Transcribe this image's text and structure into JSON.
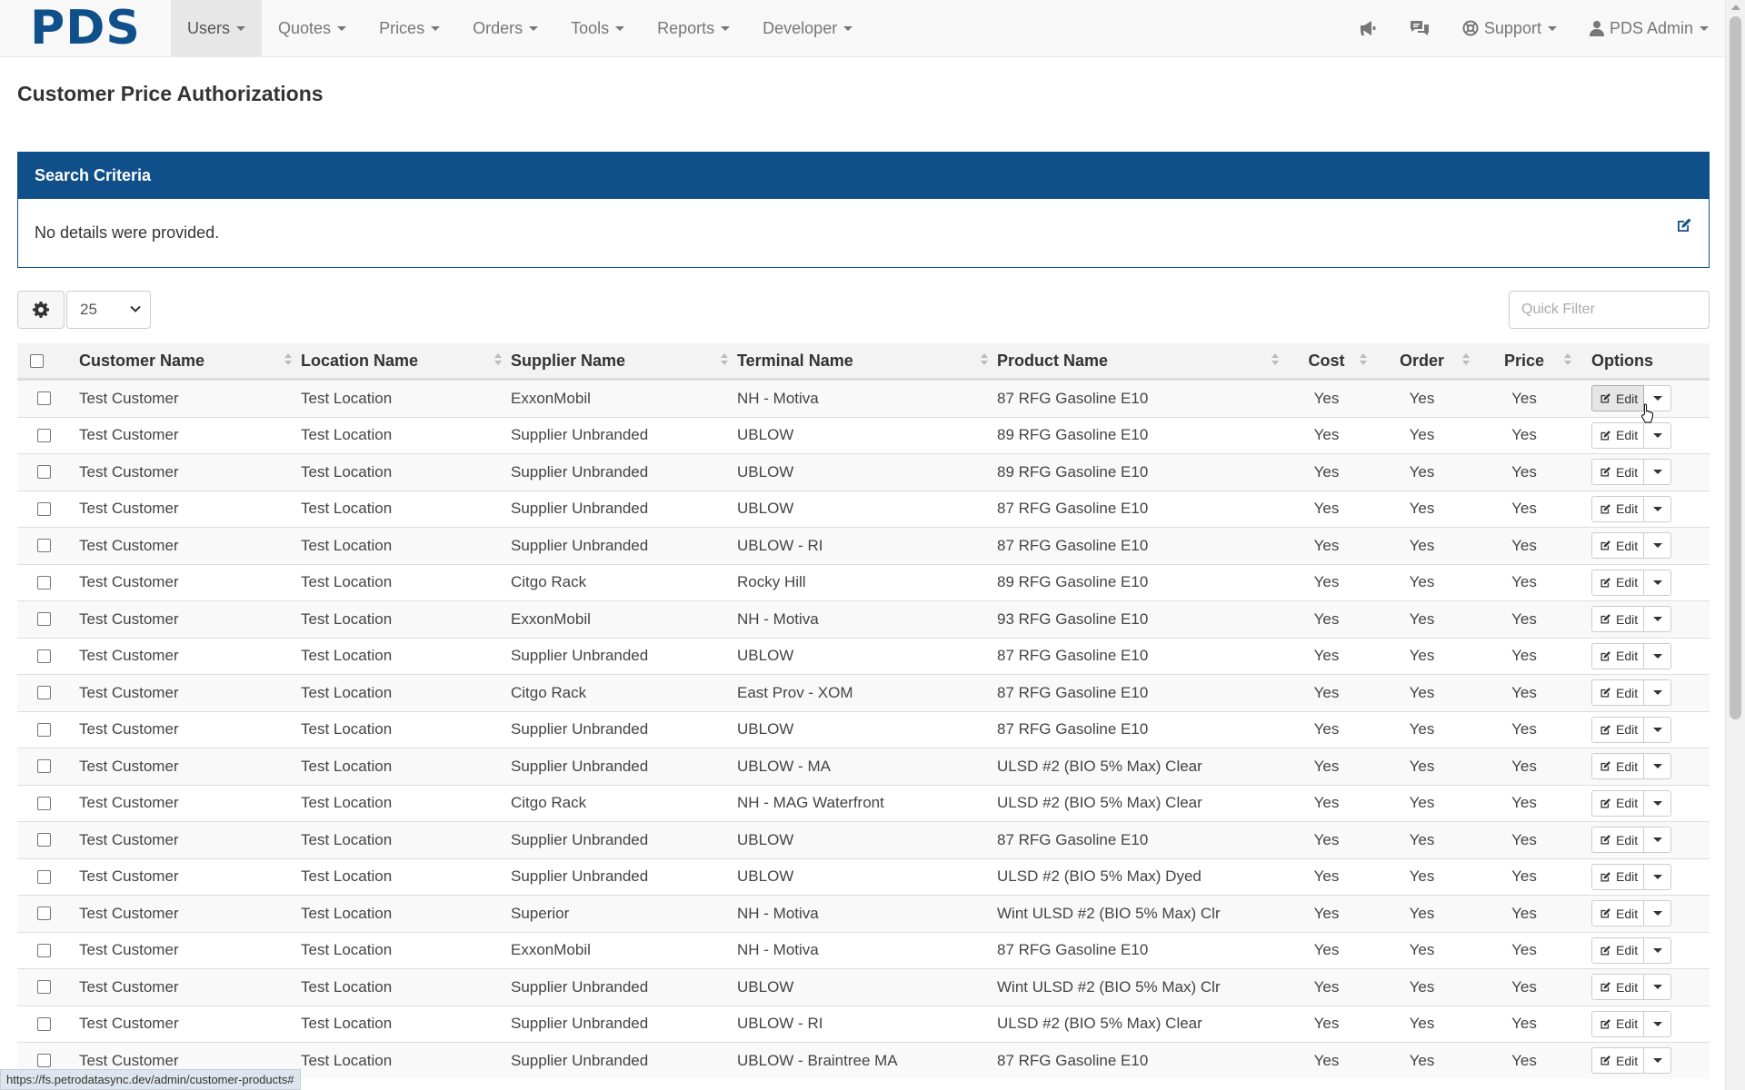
{
  "brand": "PDS",
  "nav": {
    "items": [
      {
        "label": "Users",
        "active": true
      },
      {
        "label": "Quotes"
      },
      {
        "label": "Prices"
      },
      {
        "label": "Orders"
      },
      {
        "label": "Tools"
      },
      {
        "label": "Reports"
      },
      {
        "label": "Developer"
      }
    ],
    "support": "Support",
    "user": "PDS Admin"
  },
  "page": {
    "title": "Customer Price Authorizations"
  },
  "search_panel": {
    "title": "Search Criteria",
    "body": "No details were provided."
  },
  "toolbar": {
    "page_size": "25",
    "quick_filter_placeholder": "Quick Filter"
  },
  "table": {
    "columns": [
      "Customer Name",
      "Location Name",
      "Supplier Name",
      "Terminal Name",
      "Product Name",
      "Cost",
      "Order",
      "Price",
      "Options"
    ],
    "edit_label": "Edit",
    "rows": [
      [
        "Test Customer",
        "Test Location",
        "ExxonMobil",
        "NH - Motiva",
        "87 RFG Gasoline E10",
        "Yes",
        "Yes",
        "Yes"
      ],
      [
        "Test Customer",
        "Test Location",
        "Supplier Unbranded",
        "UBLOW",
        "89 RFG Gasoline E10",
        "Yes",
        "Yes",
        "Yes"
      ],
      [
        "Test Customer",
        "Test Location",
        "Supplier Unbranded",
        "UBLOW",
        "89 RFG Gasoline E10",
        "Yes",
        "Yes",
        "Yes"
      ],
      [
        "Test Customer",
        "Test Location",
        "Supplier Unbranded",
        "UBLOW",
        "87 RFG Gasoline E10",
        "Yes",
        "Yes",
        "Yes"
      ],
      [
        "Test Customer",
        "Test Location",
        "Supplier Unbranded",
        "UBLOW - RI",
        "87 RFG Gasoline E10",
        "Yes",
        "Yes",
        "Yes"
      ],
      [
        "Test Customer",
        "Test Location",
        "Citgo Rack",
        "Rocky Hill",
        "89 RFG Gasoline E10",
        "Yes",
        "Yes",
        "Yes"
      ],
      [
        "Test Customer",
        "Test Location",
        "ExxonMobil",
        "NH - Motiva",
        "93 RFG Gasoline E10",
        "Yes",
        "Yes",
        "Yes"
      ],
      [
        "Test Customer",
        "Test Location",
        "Supplier Unbranded",
        "UBLOW",
        "87 RFG Gasoline E10",
        "Yes",
        "Yes",
        "Yes"
      ],
      [
        "Test Customer",
        "Test Location",
        "Citgo Rack",
        "East Prov - XOM",
        "87 RFG Gasoline E10",
        "Yes",
        "Yes",
        "Yes"
      ],
      [
        "Test Customer",
        "Test Location",
        "Supplier Unbranded",
        "UBLOW",
        "87 RFG Gasoline E10",
        "Yes",
        "Yes",
        "Yes"
      ],
      [
        "Test Customer",
        "Test Location",
        "Supplier Unbranded",
        "UBLOW - MA",
        "ULSD #2 (BIO 5% Max) Clear",
        "Yes",
        "Yes",
        "Yes"
      ],
      [
        "Test Customer",
        "Test Location",
        "Citgo Rack",
        "NH - MAG Waterfront",
        "ULSD #2 (BIO 5% Max) Clear",
        "Yes",
        "Yes",
        "Yes"
      ],
      [
        "Test Customer",
        "Test Location",
        "Supplier Unbranded",
        "UBLOW",
        "87 RFG Gasoline E10",
        "Yes",
        "Yes",
        "Yes"
      ],
      [
        "Test Customer",
        "Test Location",
        "Supplier Unbranded",
        "UBLOW",
        "ULSD #2 (BIO 5% Max) Dyed",
        "Yes",
        "Yes",
        "Yes"
      ],
      [
        "Test Customer",
        "Test Location",
        "Superior",
        "NH - Motiva",
        "Wint ULSD #2 (BIO 5% Max) Clr",
        "Yes",
        "Yes",
        "Yes"
      ],
      [
        "Test Customer",
        "Test Location",
        "ExxonMobil",
        "NH - Motiva",
        "87 RFG Gasoline E10",
        "Yes",
        "Yes",
        "Yes"
      ],
      [
        "Test Customer",
        "Test Location",
        "Supplier Unbranded",
        "UBLOW",
        "Wint ULSD #2 (BIO 5% Max) Clr",
        "Yes",
        "Yes",
        "Yes"
      ],
      [
        "Test Customer",
        "Test Location",
        "Supplier Unbranded",
        "UBLOW - RI",
        "ULSD #2 (BIO 5% Max) Clear",
        "Yes",
        "Yes",
        "Yes"
      ],
      [
        "Test Customer",
        "Test Location",
        "Supplier Unbranded",
        "UBLOW - Braintree MA",
        "87 RFG Gasoline E10",
        "Yes",
        "Yes",
        "Yes"
      ]
    ]
  },
  "status_bar": {
    "url": "https://fs.petrodatasync.dev/admin/customer-products#"
  }
}
